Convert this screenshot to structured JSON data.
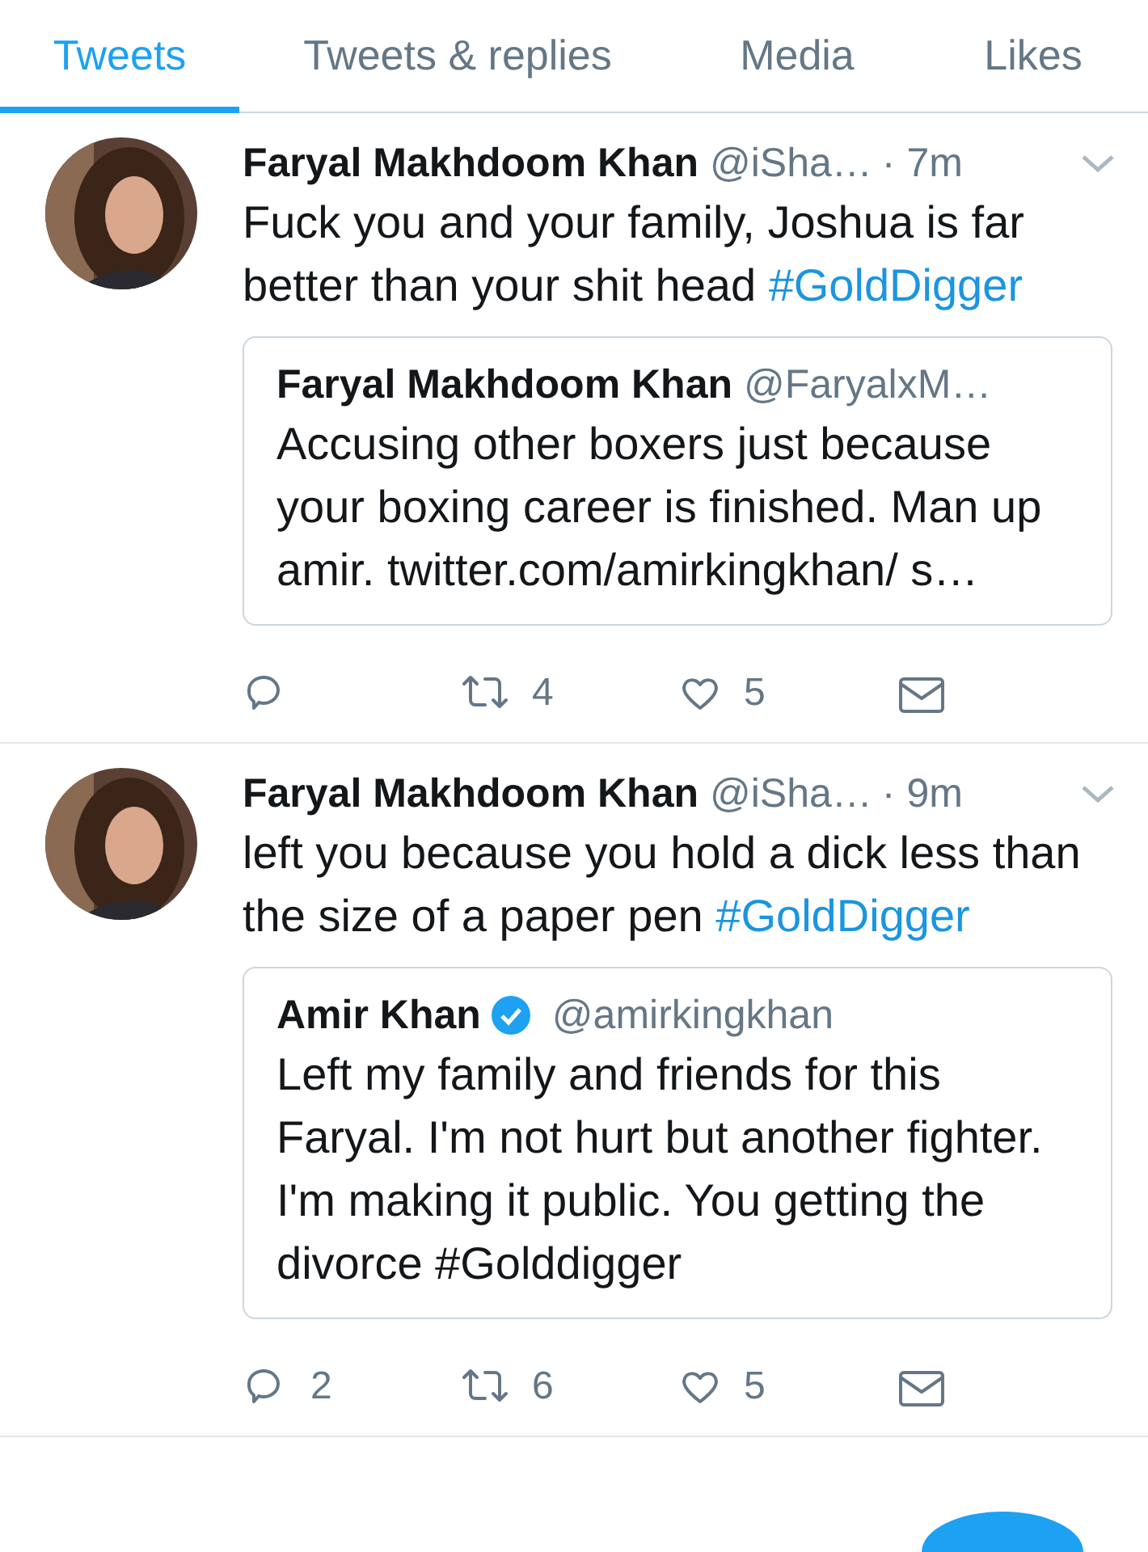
{
  "tabs": [
    {
      "label": "Tweets",
      "selected": true
    },
    {
      "label": "Tweets & replies",
      "selected": false
    },
    {
      "label": "Media",
      "selected": false
    },
    {
      "label": "Likes",
      "selected": false
    }
  ],
  "tweets": [
    {
      "name": "Faryal Makhdoom Khan",
      "handle": "@iSha…",
      "time": "· 7m",
      "text": "Fuck you and your family, Joshua is far better than your shit head",
      "hashtag": "#GoldDigger",
      "quote": {
        "name": "Faryal Makhdoom Khan",
        "verified": false,
        "handle": "@FaryalxM…",
        "text": "Accusing other boxers just because your boxing career is finished. Man up amir. twitter.com/amirkingkhan/ s…"
      },
      "retweets": "4",
      "likes": "5"
    },
    {
      "name": "Faryal Makhdoom Khan",
      "handle": "@iSha…",
      "time": "· 9m",
      "text": "left you because you hold a dick less than the size of a paper pen",
      "hashtag": "#GoldDigger",
      "quote": {
        "name": "Amir Khan",
        "verified": true,
        "handle": "@amirkingkhan",
        "text": "Left my family and friends for this Faryal. I'm not hurt but another fighter. I'm making it public. You getting the divorce #Golddigger"
      },
      "replies": "2",
      "retweets": "6",
      "likes": "5"
    }
  ]
}
